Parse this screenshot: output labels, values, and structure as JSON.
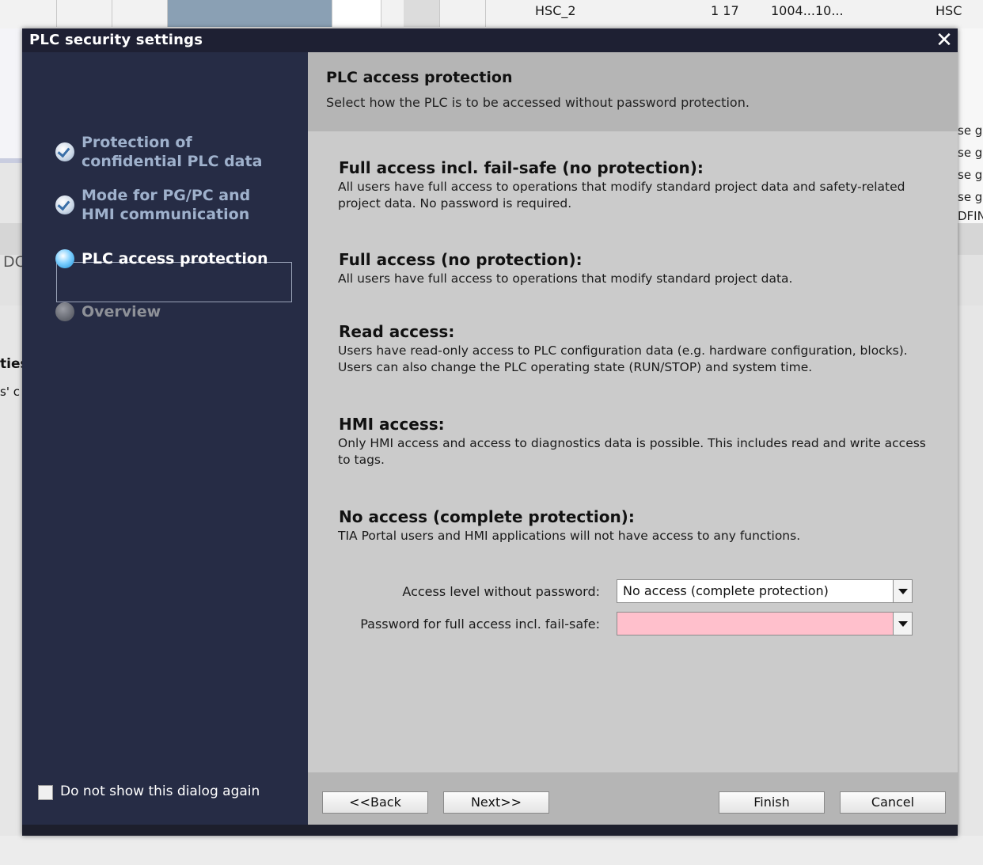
{
  "background": {
    "table_row": [
      "HSC_2",
      "1 17",
      "1004...10...",
      "HSC"
    ],
    "right_column": [
      "",
      "",
      "",
      "",
      "se g",
      "se g",
      "se g",
      "se g",
      "DFIN"
    ],
    "side_fragments": [
      "DC",
      "ties",
      "s' c"
    ]
  },
  "dialog": {
    "title": "PLC security settings",
    "close_glyph": "✕"
  },
  "nav": {
    "items": [
      {
        "label": "Protection of confidential PLC data",
        "state": "done"
      },
      {
        "label": "Mode for PG/PC and HMI communication",
        "state": "done"
      },
      {
        "label": "PLC access protection",
        "state": "active"
      },
      {
        "label": "Overview",
        "state": "pending"
      }
    ],
    "dont_show": "Do not show this dialog again"
  },
  "content": {
    "title": "PLC access protection",
    "subtitle": "Select how the PLC is to be accessed without password protection.",
    "options": [
      {
        "title": "Full access incl. fail-safe (no protection):",
        "desc": "All users have full access to operations that modify standard project data and safety-related project data. No password is required."
      },
      {
        "title": "Full access (no protection):",
        "desc": "All users have full access to operations that modify standard project data."
      },
      {
        "title": "Read access:",
        "desc": "Users have read-only access to PLC configuration data (e.g. hardware configuration, blocks). Users can also change the PLC operating state (RUN/STOP) and system time."
      },
      {
        "title": "HMI access:",
        "desc": "Only HMI access and access to diagnostics data is possible. This includes read and write access to tags."
      },
      {
        "title": "No access (complete protection):",
        "desc": "TIA Portal users and HMI applications will not have access to any functions."
      }
    ],
    "form": {
      "access_level_label": "Access level without password:",
      "access_level_value": "No access (complete protection)",
      "password_label": "Password for full access incl. fail-safe:",
      "password_value": ""
    }
  },
  "buttons": {
    "back": "<<Back",
    "next": "Next>>",
    "finish": "Finish",
    "cancel": "Cancel"
  },
  "colors": {
    "nav_bg": "#262c45",
    "content_bg": "#cbcbcb",
    "header_bg": "#b5b5b5",
    "nav_done": "#9fb1cc",
    "password_field": "#ffc0cc"
  }
}
